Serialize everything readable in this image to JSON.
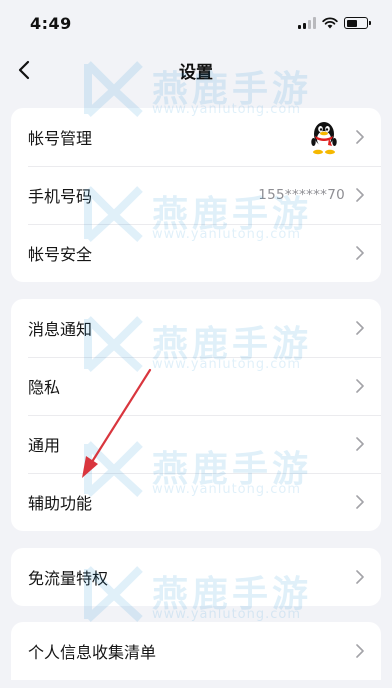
{
  "status_bar": {
    "time": "4:49"
  },
  "nav": {
    "title": "设置"
  },
  "groups": {
    "account": [
      {
        "label": "帐号管理"
      },
      {
        "label": "手机号码",
        "value": "155******70"
      },
      {
        "label": "帐号安全"
      }
    ],
    "general": [
      {
        "label": "消息通知"
      },
      {
        "label": "隐私"
      },
      {
        "label": "通用"
      },
      {
        "label": "辅助功能"
      }
    ],
    "traffic": [
      {
        "label": "免流量特权"
      }
    ],
    "info": [
      {
        "label": "个人信息收集清单"
      }
    ]
  },
  "watermark": {
    "brand": "燕鹿手游",
    "url": "www.yanlutong.com"
  },
  "colors": {
    "background": "#f2f3f7",
    "card": "#ffffff",
    "annotation": "#d9363e"
  }
}
